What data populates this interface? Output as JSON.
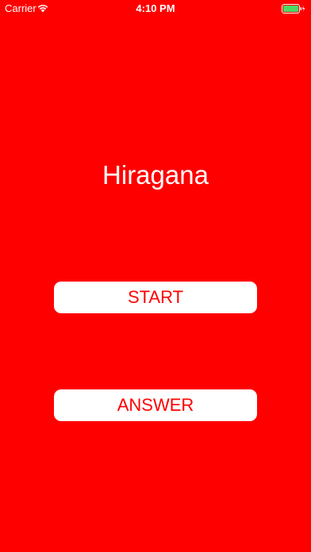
{
  "status_bar": {
    "carrier": "Carrier",
    "time": "4:10 PM",
    "wifi_icon": "wifi-icon",
    "battery_icon": "battery-icon",
    "battery_color": "#4cd964"
  },
  "main": {
    "title": "Hiragana",
    "start_label": "START",
    "answer_label": "ANSWER"
  },
  "colors": {
    "background": "#ff0000",
    "button_background": "#ffffff",
    "button_text": "#ff0000",
    "title_text": "#ffffff"
  }
}
